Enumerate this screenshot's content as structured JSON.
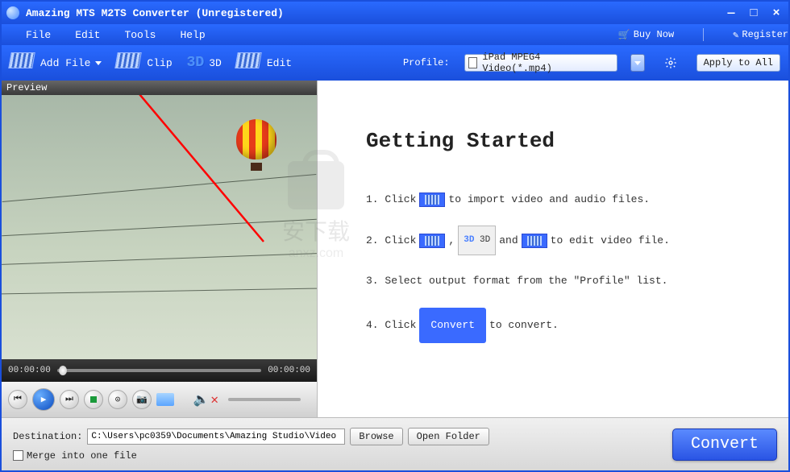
{
  "title": "Amazing MTS M2TS Converter (Unregistered)",
  "menu": {
    "file": "File",
    "edit": "Edit",
    "tools": "Tools",
    "help": "Help"
  },
  "header": {
    "buynow": "Buy Now",
    "register": "Register"
  },
  "toolbar": {
    "addfile": "Add File",
    "clip": "Clip",
    "d3": "3D",
    "edit": "Edit",
    "profile_label": "Profile:",
    "profile_value": "iPad MPEG4 Video(*.mp4)",
    "apply": "Apply to All"
  },
  "preview": {
    "label": "Preview",
    "time_current": "00:00:00",
    "time_total": "00:00:00"
  },
  "guide": {
    "heading": "Getting Started",
    "s1a": "1. Click",
    "s1b": "to import video and audio files.",
    "s2a": "2. Click",
    "s2b": ",",
    "s2_3d": "3D",
    "s2c": "and",
    "s2d": "to edit video file.",
    "s3": "3. Select output format from the \"Profile\" list.",
    "s4a": "4. Click",
    "s4_btn": "Convert",
    "s4b": "to convert."
  },
  "watermark": {
    "line1": "安下载",
    "line2": "anxz.com"
  },
  "bottom": {
    "dest_label": "Destination:",
    "dest_value": "C:\\Users\\pc0359\\Documents\\Amazing Studio\\Video",
    "browse": "Browse",
    "open": "Open Folder",
    "merge": "Merge into one file",
    "convert": "Convert"
  }
}
